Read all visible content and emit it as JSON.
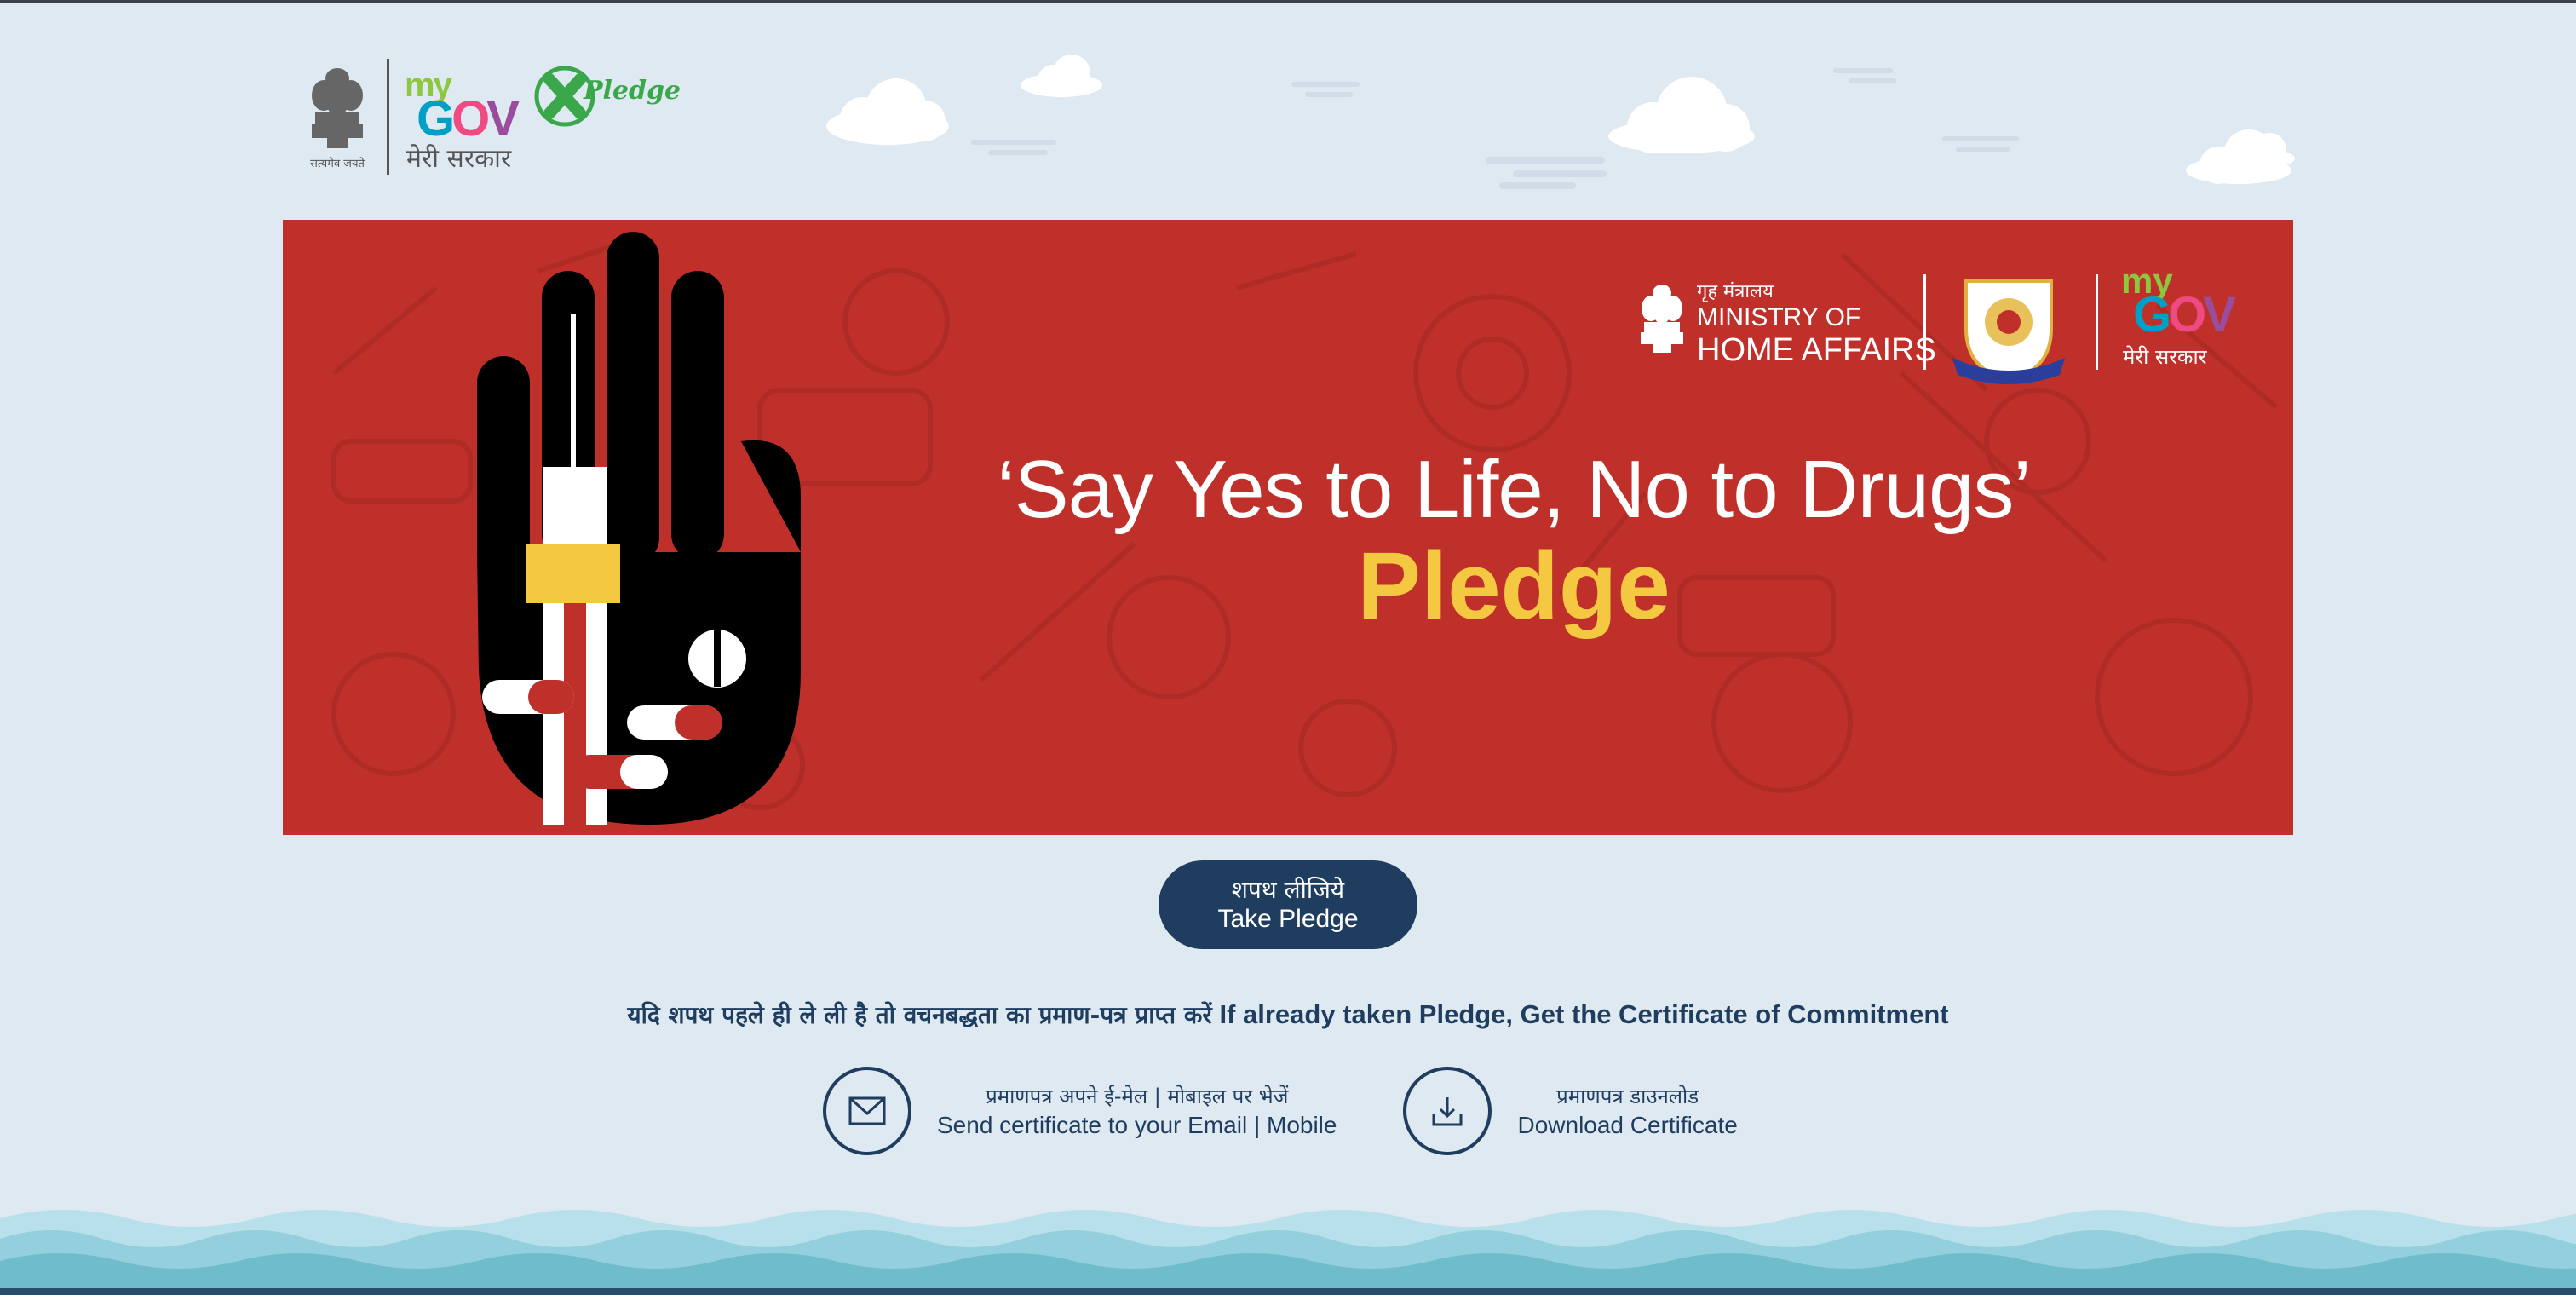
{
  "header": {
    "emblem_caption": "सत्यमेव जयते",
    "mygov_my": "my",
    "mygov_gov_g": "G",
    "mygov_gov_o": "O",
    "mygov_gov_v": "V",
    "mygov_hindi": "मेरी सरकार",
    "pledge_logo_text": "Pledge"
  },
  "banner": {
    "headline": "‘Say Yes to Life, No to Drugs’",
    "subheadline": "Pledge",
    "mha_hindi": "गृह मंत्रालय",
    "mha_line1": "MINISTRY OF",
    "mha_line2": "HOME AFFAIRS",
    "mygov_my": "my",
    "mygov_gov_g": "G",
    "mygov_gov_o": "O",
    "mygov_gov_v": "V",
    "mygov_hindi": "मेरी सरकार"
  },
  "take_pledge": {
    "label_hi": "शपथ लीजिये",
    "label_en": "Take Pledge"
  },
  "already_taken": {
    "text_hi": "यदि शपथ पहले ही ले ली है तो वचनबद्धता का प्रमाण-पत्र प्राप्त करें",
    "text_en": "If already taken Pledge, Get the Certificate of Commitment"
  },
  "actions": [
    {
      "icon": "mail-icon",
      "label_hi": "प्रमाणपत्र अपने ई-मेल | मोबाइल पर भेजें",
      "label_en": "Send certificate to your Email | Mobile"
    },
    {
      "icon": "download-icon",
      "label_hi": "प्रमाणपत्र डाउनलोड",
      "label_en": "Download Certificate"
    }
  ],
  "colors": {
    "background": "#dfe9f2",
    "banner_red": "#c0302b",
    "navy": "#1f3d5e",
    "pledge_yellow": "#f5c842"
  }
}
